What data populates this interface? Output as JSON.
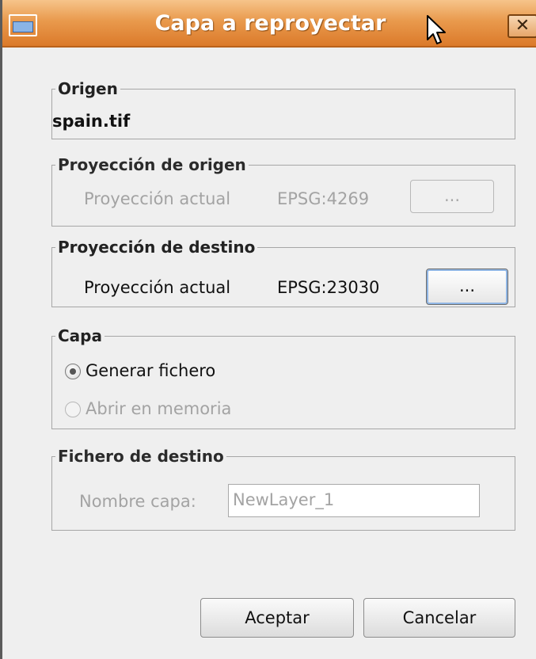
{
  "window": {
    "title": "Capa a reproyectar",
    "close_label": "✕"
  },
  "origen": {
    "legend": "Origen",
    "file": "spain.tif"
  },
  "proy_origen": {
    "legend": "Proyección de origen",
    "label": "Proyección actual",
    "code": "EPSG:4269",
    "button_label": "..."
  },
  "proy_destino": {
    "legend": "Proyección de destino",
    "label": "Proyección actual",
    "code": "EPSG:23030",
    "button_label": "..."
  },
  "capa": {
    "legend": "Capa",
    "option1": "Generar fichero",
    "option2": "Abrir en memoria",
    "selected": "Generar fichero"
  },
  "fichero": {
    "legend": "Fichero de destino",
    "label": "Nombre capa:",
    "value": "NewLayer_1"
  },
  "footer": {
    "ok_label": "Aceptar",
    "cancel_label": "Cancelar"
  }
}
